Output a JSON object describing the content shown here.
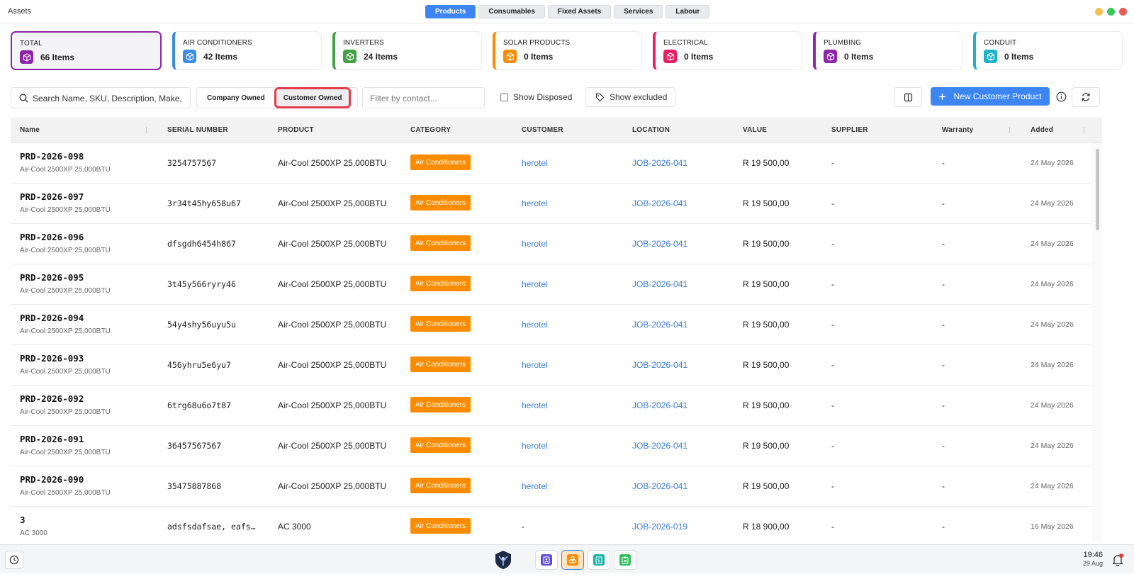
{
  "window": {
    "title": "Assets",
    "tabs": [
      {
        "label": "Products",
        "active": true
      },
      {
        "label": "Consumables",
        "active": false
      },
      {
        "label": "Fixed Assets",
        "active": false
      },
      {
        "label": "Services",
        "active": false
      },
      {
        "label": "Labour",
        "active": false
      }
    ],
    "controls": {
      "minimize_color": "#f6be4f",
      "maximize_color": "#39c759",
      "close_color": "#ee5a55"
    }
  },
  "summary_cards": [
    {
      "label": "TOTAL",
      "count": "66 Items",
      "color": "#8e24aa",
      "icon": "box-icon"
    },
    {
      "label": "AIR CONDITIONERS",
      "count": "42 Items",
      "color": "#3a8ee6",
      "icon": "box-icon"
    },
    {
      "label": "INVERTERS",
      "count": "24 Items",
      "color": "#43a047",
      "icon": "box-icon"
    },
    {
      "label": "SOLAR PRODUCTS",
      "count": "0 Items",
      "color": "#fb8c00",
      "icon": "box-icon"
    },
    {
      "label": "ELECTRICAL",
      "count": "0 Items",
      "color": "#e91e63",
      "icon": "box-icon"
    },
    {
      "label": "PLUMBING",
      "count": "0 Items",
      "color": "#8e24aa",
      "icon": "box-icon"
    },
    {
      "label": "CONDUIT",
      "count": "0 Items",
      "color": "#1ab3c7",
      "icon": "box-icon"
    }
  ],
  "toolbar": {
    "search_placeholder": "Search Name, SKU, Description, Make,",
    "company_owned_label": "Company Owned",
    "customer_owned_label": "Customer Owned",
    "contact_filter_placeholder": "Filter by contact...",
    "show_disposed_label": "Show Disposed",
    "show_excluded_label": "Show excluded",
    "new_button_label": "New Customer Product",
    "accent_color": "#3d86f2"
  },
  "table": {
    "columns": [
      "Name",
      "SERIAL NUMBER",
      "PRODUCT",
      "CATEGORY",
      "CUSTOMER",
      "LOCATION",
      "VALUE",
      "SUPPLIER",
      "Warranty",
      "Added"
    ],
    "rows": [
      {
        "name": "PRD-2026-098",
        "sub": "Air-Cool 2500XP 25,000BTU",
        "serial": "3254757567",
        "product": "Air-Cool 2500XP 25,000BTU",
        "category": "Air Conditioners",
        "customer": "herotel",
        "location": "JOB-2026-041",
        "value": "R 19 500,00",
        "supplier": "-",
        "warranty": "-",
        "added": "24 May 2026"
      },
      {
        "name": "PRD-2026-097",
        "sub": "Air-Cool 2500XP 25,000BTU",
        "serial": "3r34t45hy658u67",
        "product": "Air-Cool 2500XP 25,000BTU",
        "category": "Air Conditioners",
        "customer": "herotel",
        "location": "JOB-2026-041",
        "value": "R 19 500,00",
        "supplier": "-",
        "warranty": "-",
        "added": "24 May 2026"
      },
      {
        "name": "PRD-2026-096",
        "sub": "Air-Cool 2500XP 25,000BTU",
        "serial": "dfsgdh6454h867",
        "product": "Air-Cool 2500XP 25,000BTU",
        "category": "Air Conditioners",
        "customer": "herotel",
        "location": "JOB-2026-041",
        "value": "R 19 500,00",
        "supplier": "-",
        "warranty": "-",
        "added": "24 May 2026"
      },
      {
        "name": "PRD-2026-095",
        "sub": "Air-Cool 2500XP 25,000BTU",
        "serial": "3t45y566ryry46",
        "product": "Air-Cool 2500XP 25,000BTU",
        "category": "Air Conditioners",
        "customer": "herotel",
        "location": "JOB-2026-041",
        "value": "R 19 500,00",
        "supplier": "-",
        "warranty": "-",
        "added": "24 May 2026"
      },
      {
        "name": "PRD-2026-094",
        "sub": "Air-Cool 2500XP 25,000BTU",
        "serial": "54y4shy56uyu5u",
        "product": "Air-Cool 2500XP 25,000BTU",
        "category": "Air Conditioners",
        "customer": "herotel",
        "location": "JOB-2026-041",
        "value": "R 19 500,00",
        "supplier": "-",
        "warranty": "-",
        "added": "24 May 2026"
      },
      {
        "name": "PRD-2026-093",
        "sub": "Air-Cool 2500XP 25,000BTU",
        "serial": "456yhru5e6yu7",
        "product": "Air-Cool 2500XP 25,000BTU",
        "category": "Air Conditioners",
        "customer": "herotel",
        "location": "JOB-2026-041",
        "value": "R 19 500,00",
        "supplier": "-",
        "warranty": "-",
        "added": "24 May 2026"
      },
      {
        "name": "PRD-2026-092",
        "sub": "Air-Cool 2500XP 25,000BTU",
        "serial": "6trg68u6o7t87",
        "product": "Air-Cool 2500XP 25,000BTU",
        "category": "Air Conditioners",
        "customer": "herotel",
        "location": "JOB-2026-041",
        "value": "R 19 500,00",
        "supplier": "-",
        "warranty": "-",
        "added": "24 May 2026"
      },
      {
        "name": "PRD-2026-091",
        "sub": "Air-Cool 2500XP 25,000BTU",
        "serial": "36457567567",
        "product": "Air-Cool 2500XP 25,000BTU",
        "category": "Air Conditioners",
        "customer": "herotel",
        "location": "JOB-2026-041",
        "value": "R 19 500,00",
        "supplier": "-",
        "warranty": "-",
        "added": "24 May 2026"
      },
      {
        "name": "PRD-2026-090",
        "sub": "Air-Cool 2500XP 25,000BTU",
        "serial": "35475887868",
        "product": "Air-Cool 2500XP 25,000BTU",
        "category": "Air Conditioners",
        "customer": "herotel",
        "location": "JOB-2026-041",
        "value": "R 19 500,00",
        "supplier": "-",
        "warranty": "-",
        "added": "24 May 2026"
      },
      {
        "name": "3",
        "sub": "AC 3000",
        "serial": "adsfsdafsae, eafs…",
        "product": "AC 3000",
        "category": "Air Conditioners",
        "customer": "-",
        "location": "JOB-2026-019",
        "value": "R 18 900,00",
        "supplier": "-",
        "warranty": "-",
        "added": "16 May 2026"
      }
    ]
  },
  "taskbar": {
    "time": "19:46",
    "date": "29 Aug",
    "dock": [
      {
        "icon": "contacts-icon",
        "color": "#5c4fc9",
        "active": false
      },
      {
        "icon": "assets-icon",
        "color": "#fb8c00",
        "active": true
      },
      {
        "icon": "invoice-icon",
        "color": "#17b3a3",
        "active": false
      },
      {
        "icon": "clipboard-icon",
        "color": "#2fbf5a",
        "active": false
      }
    ]
  }
}
